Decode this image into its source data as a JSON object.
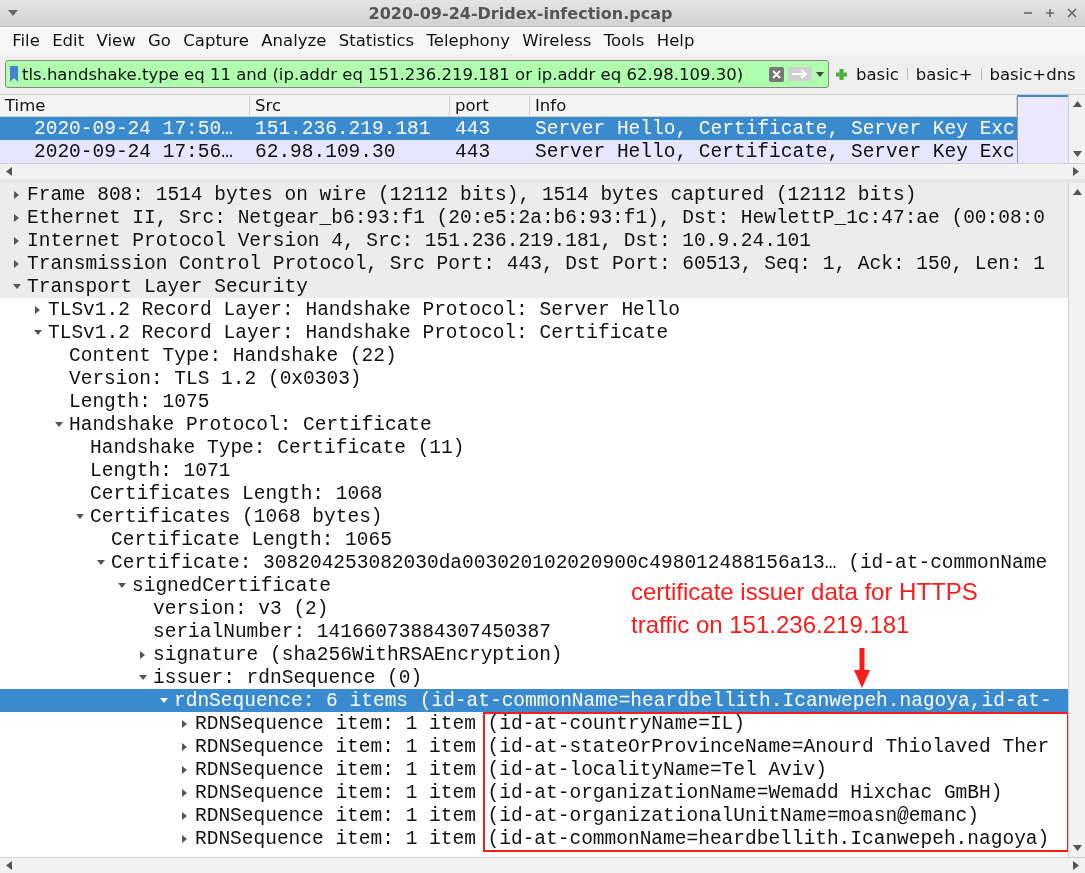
{
  "window": {
    "title": "2020-09-24-Dridex-infection.pcap"
  },
  "menu": [
    "File",
    "Edit",
    "View",
    "Go",
    "Capture",
    "Analyze",
    "Statistics",
    "Telephony",
    "Wireless",
    "Tools",
    "Help"
  ],
  "display_filter": {
    "value": "tls.handshake.type eq 11 and (ip.addr eq 151.236.219.181 or ip.addr eq 62.98.109.30)",
    "valid": true
  },
  "filter_buttons": [
    "basic",
    "basic+",
    "basic+dns"
  ],
  "packet_list": {
    "columns": [
      "Time",
      "Src",
      "port",
      "Info"
    ],
    "rows": [
      {
        "cells": [
          "2020-09-24 17:50…",
          "151.236.219.181",
          "443",
          "Server Hello, Certificate, Server Key Exc"
        ],
        "selected": true
      },
      {
        "cells": [
          "2020-09-24 17:56…",
          "62.98.109.30",
          "443",
          "Server Hello, Certificate, Server Key Exc"
        ],
        "selected": false
      }
    ]
  },
  "details": [
    {
      "label": "Frame 808: 1514 bytes on wire (12112 bits), 1514 bytes captured (12112 bits)",
      "kind": "node",
      "expanded": false,
      "selected": false
    },
    {
      "label": "Ethernet II, Src: Netgear_b6:93:f1 (20:e5:2a:b6:93:f1), Dst: HewlettP_1c:47:ae (00:08:0",
      "kind": "node",
      "expanded": false,
      "selected": false
    },
    {
      "label": "Internet Protocol Version 4, Src: 151.236.219.181, Dst: 10.9.24.101",
      "kind": "node",
      "expanded": false,
      "selected": false
    },
    {
      "label": "Transmission Control Protocol, Src Port: 443, Dst Port: 60513, Seq: 1, Ack: 150, Len: 1",
      "kind": "node",
      "expanded": false,
      "selected": false
    },
    {
      "label": "Transport Layer Security",
      "kind": "node",
      "expanded": true,
      "selected": false,
      "children": [
        {
          "label": "TLSv1.2 Record Layer: Handshake Protocol: Server Hello",
          "kind": "node",
          "expanded": false,
          "selected": false
        },
        {
          "label": "TLSv1.2 Record Layer: Handshake Protocol: Certificate",
          "kind": "node",
          "expanded": true,
          "selected": false,
          "children": [
            {
              "label": "Content Type: Handshake (22)",
              "kind": "leaf",
              "selected": false
            },
            {
              "label": "Version: TLS 1.2 (0x0303)",
              "kind": "leaf",
              "selected": false
            },
            {
              "label": "Length: 1075",
              "kind": "leaf",
              "selected": false
            },
            {
              "label": "Handshake Protocol: Certificate",
              "kind": "node",
              "expanded": true,
              "selected": false,
              "children": [
                {
                  "label": "Handshake Type: Certificate (11)",
                  "kind": "leaf",
                  "selected": false
                },
                {
                  "label": "Length: 1071",
                  "kind": "leaf",
                  "selected": false
                },
                {
                  "label": "Certificates Length: 1068",
                  "kind": "leaf",
                  "selected": false
                },
                {
                  "label": "Certificates (1068 bytes)",
                  "kind": "node",
                  "expanded": true,
                  "selected": false,
                  "children": [
                    {
                      "label": "Certificate Length: 1065",
                      "kind": "leaf",
                      "selected": false
                    },
                    {
                      "label": "Certificate: 308204253082030da003020102020900c498012488156a13… (id-at-commonName",
                      "kind": "node",
                      "expanded": true,
                      "selected": false,
                      "children": [
                        {
                          "label": "signedCertificate",
                          "kind": "node",
                          "expanded": true,
                          "selected": false,
                          "children": [
                            {
                              "label": "version: v3 (2)",
                              "kind": "leaf",
                              "selected": false
                            },
                            {
                              "label": "serialNumber: 14166073884307450387",
                              "kind": "leaf",
                              "selected": false
                            },
                            {
                              "label": "signature (sha256WithRSAEncryption)",
                              "kind": "node",
                              "expanded": false,
                              "selected": false
                            },
                            {
                              "label": "issuer: rdnSequence (0)",
                              "kind": "node",
                              "expanded": true,
                              "selected": false,
                              "children": [
                                {
                                  "label": "rdnSequence: 6 items (id-at-commonName=heardbellith.Icanwepeh.nagoya,id-at-",
                                  "kind": "node",
                                  "expanded": true,
                                  "selected": true,
                                  "children": [
                                    {
                                      "label": "RDNSequence item: 1 item (id-at-countryName=IL)",
                                      "kind": "node",
                                      "expanded": false,
                                      "selected": false
                                    },
                                    {
                                      "label": "RDNSequence item: 1 item (id-at-stateOrProvinceName=Anourd Thiolaved Ther",
                                      "kind": "node",
                                      "expanded": false,
                                      "selected": false
                                    },
                                    {
                                      "label": "RDNSequence item: 1 item (id-at-localityName=Tel Aviv)",
                                      "kind": "node",
                                      "expanded": false,
                                      "selected": false
                                    },
                                    {
                                      "label": "RDNSequence item: 1 item (id-at-organizationName=Wemadd Hixchac GmBH)",
                                      "kind": "node",
                                      "expanded": false,
                                      "selected": false
                                    },
                                    {
                                      "label": "RDNSequence item: 1 item (id-at-organizationalUnitName=moasn@emanc)",
                                      "kind": "node",
                                      "expanded": false,
                                      "selected": false
                                    },
                                    {
                                      "label": "RDNSequence item: 1 item (id-at-commonName=heardbellith.Icanwepeh.nagoya)",
                                      "kind": "node",
                                      "expanded": false,
                                      "selected": false
                                    }
                                  ]
                                }
                              ]
                            }
                          ]
                        }
                      ]
                    }
                  ]
                }
              ]
            }
          ]
        }
      ]
    }
  ],
  "annotation": {
    "text": "certificate issuer data for HTTPS\ntraffic on 151.236.219.181"
  }
}
